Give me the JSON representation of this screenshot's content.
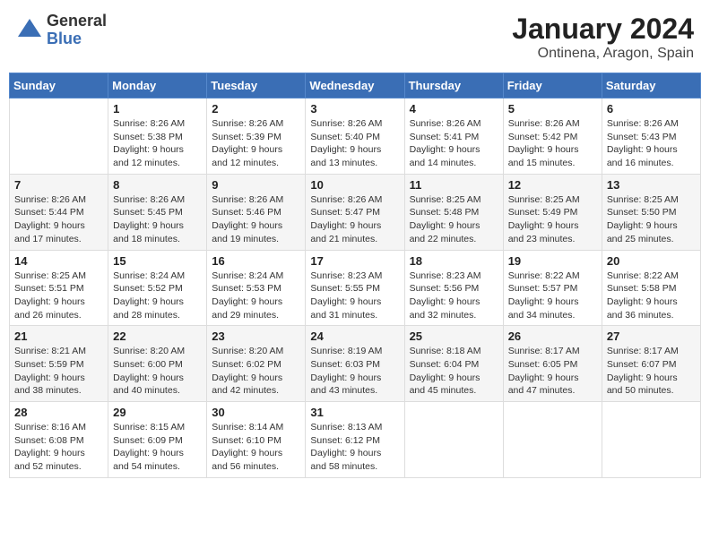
{
  "logo": {
    "general": "General",
    "blue": "Blue"
  },
  "title": "January 2024",
  "subtitle": "Ontinena, Aragon, Spain",
  "days_of_week": [
    "Sunday",
    "Monday",
    "Tuesday",
    "Wednesday",
    "Thursday",
    "Friday",
    "Saturday"
  ],
  "weeks": [
    [
      {
        "day": "",
        "info": ""
      },
      {
        "day": "1",
        "info": "Sunrise: 8:26 AM\nSunset: 5:38 PM\nDaylight: 9 hours\nand 12 minutes."
      },
      {
        "day": "2",
        "info": "Sunrise: 8:26 AM\nSunset: 5:39 PM\nDaylight: 9 hours\nand 12 minutes."
      },
      {
        "day": "3",
        "info": "Sunrise: 8:26 AM\nSunset: 5:40 PM\nDaylight: 9 hours\nand 13 minutes."
      },
      {
        "day": "4",
        "info": "Sunrise: 8:26 AM\nSunset: 5:41 PM\nDaylight: 9 hours\nand 14 minutes."
      },
      {
        "day": "5",
        "info": "Sunrise: 8:26 AM\nSunset: 5:42 PM\nDaylight: 9 hours\nand 15 minutes."
      },
      {
        "day": "6",
        "info": "Sunrise: 8:26 AM\nSunset: 5:43 PM\nDaylight: 9 hours\nand 16 minutes."
      }
    ],
    [
      {
        "day": "7",
        "info": "Sunrise: 8:26 AM\nSunset: 5:44 PM\nDaylight: 9 hours\nand 17 minutes."
      },
      {
        "day": "8",
        "info": "Sunrise: 8:26 AM\nSunset: 5:45 PM\nDaylight: 9 hours\nand 18 minutes."
      },
      {
        "day": "9",
        "info": "Sunrise: 8:26 AM\nSunset: 5:46 PM\nDaylight: 9 hours\nand 19 minutes."
      },
      {
        "day": "10",
        "info": "Sunrise: 8:26 AM\nSunset: 5:47 PM\nDaylight: 9 hours\nand 21 minutes."
      },
      {
        "day": "11",
        "info": "Sunrise: 8:25 AM\nSunset: 5:48 PM\nDaylight: 9 hours\nand 22 minutes."
      },
      {
        "day": "12",
        "info": "Sunrise: 8:25 AM\nSunset: 5:49 PM\nDaylight: 9 hours\nand 23 minutes."
      },
      {
        "day": "13",
        "info": "Sunrise: 8:25 AM\nSunset: 5:50 PM\nDaylight: 9 hours\nand 25 minutes."
      }
    ],
    [
      {
        "day": "14",
        "info": "Sunrise: 8:25 AM\nSunset: 5:51 PM\nDaylight: 9 hours\nand 26 minutes."
      },
      {
        "day": "15",
        "info": "Sunrise: 8:24 AM\nSunset: 5:52 PM\nDaylight: 9 hours\nand 28 minutes."
      },
      {
        "day": "16",
        "info": "Sunrise: 8:24 AM\nSunset: 5:53 PM\nDaylight: 9 hours\nand 29 minutes."
      },
      {
        "day": "17",
        "info": "Sunrise: 8:23 AM\nSunset: 5:55 PM\nDaylight: 9 hours\nand 31 minutes."
      },
      {
        "day": "18",
        "info": "Sunrise: 8:23 AM\nSunset: 5:56 PM\nDaylight: 9 hours\nand 32 minutes."
      },
      {
        "day": "19",
        "info": "Sunrise: 8:22 AM\nSunset: 5:57 PM\nDaylight: 9 hours\nand 34 minutes."
      },
      {
        "day": "20",
        "info": "Sunrise: 8:22 AM\nSunset: 5:58 PM\nDaylight: 9 hours\nand 36 minutes."
      }
    ],
    [
      {
        "day": "21",
        "info": "Sunrise: 8:21 AM\nSunset: 5:59 PM\nDaylight: 9 hours\nand 38 minutes."
      },
      {
        "day": "22",
        "info": "Sunrise: 8:20 AM\nSunset: 6:00 PM\nDaylight: 9 hours\nand 40 minutes."
      },
      {
        "day": "23",
        "info": "Sunrise: 8:20 AM\nSunset: 6:02 PM\nDaylight: 9 hours\nand 42 minutes."
      },
      {
        "day": "24",
        "info": "Sunrise: 8:19 AM\nSunset: 6:03 PM\nDaylight: 9 hours\nand 43 minutes."
      },
      {
        "day": "25",
        "info": "Sunrise: 8:18 AM\nSunset: 6:04 PM\nDaylight: 9 hours\nand 45 minutes."
      },
      {
        "day": "26",
        "info": "Sunrise: 8:17 AM\nSunset: 6:05 PM\nDaylight: 9 hours\nand 47 minutes."
      },
      {
        "day": "27",
        "info": "Sunrise: 8:17 AM\nSunset: 6:07 PM\nDaylight: 9 hours\nand 50 minutes."
      }
    ],
    [
      {
        "day": "28",
        "info": "Sunrise: 8:16 AM\nSunset: 6:08 PM\nDaylight: 9 hours\nand 52 minutes."
      },
      {
        "day": "29",
        "info": "Sunrise: 8:15 AM\nSunset: 6:09 PM\nDaylight: 9 hours\nand 54 minutes."
      },
      {
        "day": "30",
        "info": "Sunrise: 8:14 AM\nSunset: 6:10 PM\nDaylight: 9 hours\nand 56 minutes."
      },
      {
        "day": "31",
        "info": "Sunrise: 8:13 AM\nSunset: 6:12 PM\nDaylight: 9 hours\nand 58 minutes."
      },
      {
        "day": "",
        "info": ""
      },
      {
        "day": "",
        "info": ""
      },
      {
        "day": "",
        "info": ""
      }
    ]
  ]
}
